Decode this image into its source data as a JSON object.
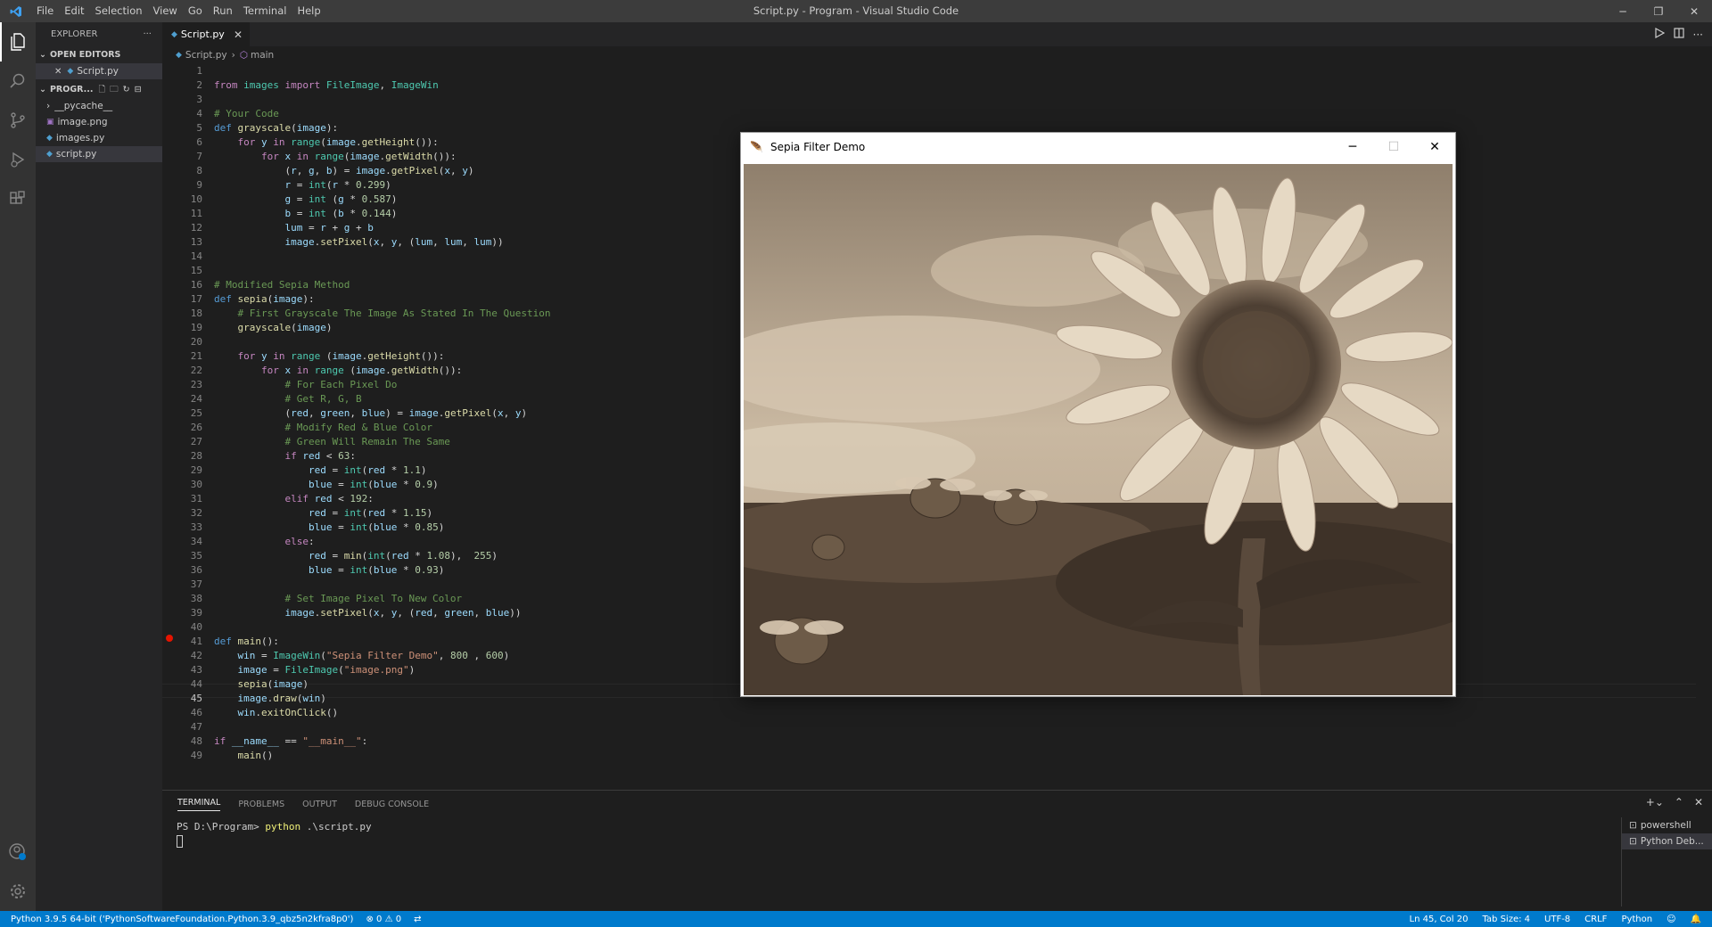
{
  "titlebar": {
    "menu": [
      "File",
      "Edit",
      "Selection",
      "View",
      "Go",
      "Run",
      "Terminal",
      "Help"
    ],
    "title": "Script.py - Program - Visual Studio Code"
  },
  "sidebar": {
    "header": "EXPLORER",
    "open_editors_label": "OPEN EDITORS",
    "open_editor_file": "Script.py",
    "project_label": "PROGR...",
    "files": [
      "__pycache__",
      "image.png",
      "images.py",
      "script.py"
    ]
  },
  "editor": {
    "tab_label": "Script.py",
    "breadcrumb_file": "Script.py",
    "breadcrumb_symbol": "main",
    "breakpoint_line": 41,
    "current_line": 45
  },
  "panel": {
    "tabs": [
      "TERMINAL",
      "PROBLEMS",
      "OUTPUT",
      "DEBUG CONSOLE"
    ],
    "prompt": "PS D:\\Program>",
    "command": "python",
    "command_arg": ".\\script.py",
    "terminals": [
      "powershell",
      "Python Deb..."
    ]
  },
  "statusbar": {
    "interpreter": "Python 3.9.5 64-bit ('PythonSoftwareFoundation.Python.3.9_qbz5n2kfra8p0')",
    "errors": "0",
    "warnings": "0",
    "position": "Ln 45, Col 20",
    "tab_size": "Tab Size: 4",
    "encoding": "UTF-8",
    "eol": "CRLF",
    "language": "Python"
  },
  "tk_window": {
    "title": "Sepia Filter Demo"
  },
  "colors": {
    "accent": "#007acc",
    "breakpoint": "#e51400"
  }
}
